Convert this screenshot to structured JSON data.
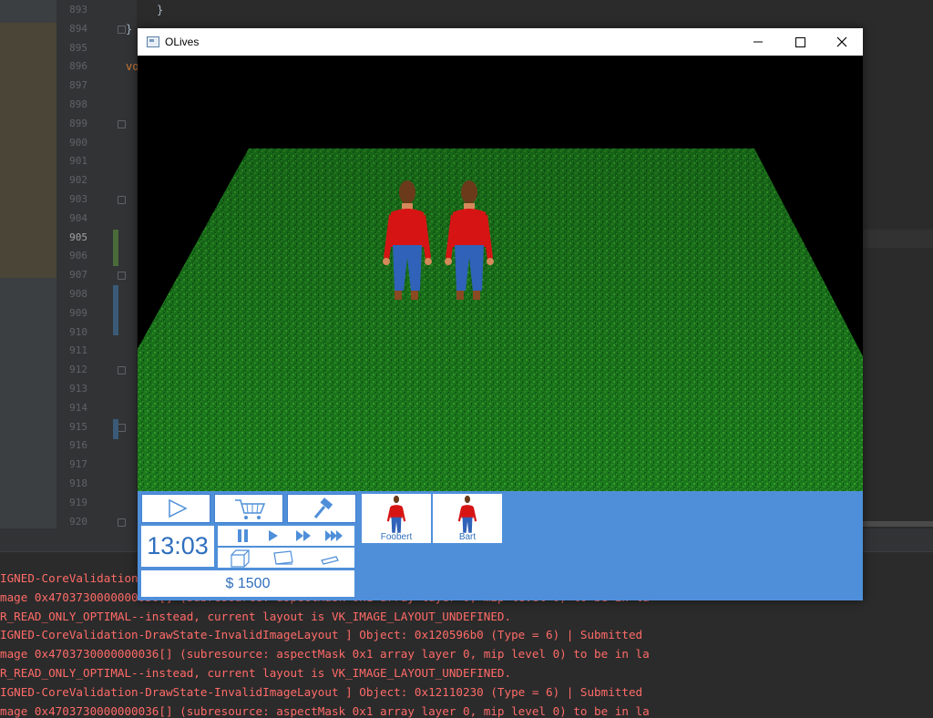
{
  "ide": {
    "line_numbers": [
      "893",
      "894",
      "895",
      "896",
      "897",
      "898",
      "899",
      "900",
      "901",
      "902",
      "903",
      "904",
      "905",
      "906",
      "907",
      "908",
      "909",
      "910",
      "911",
      "912",
      "913",
      "914",
      "915",
      "916",
      "917",
      "918",
      "919",
      "920"
    ],
    "current_line": "905",
    "code_snippets": {
      "brace_close": "}",
      "brace_line": "}",
      "fragment": "vo"
    }
  },
  "console": {
    "lines": [
      "IGNED-CoreValidation-DrawState-InvalidImageLayout ] Object: 0x12059b0 (Type = 6) | Submitted",
      "mage 0x4703730000000036[] (subresource: aspectMask 0x1 array layer 0, mip level 0) to be in la",
      "R_READ_ONLY_OPTIMAL--instead, current layout is VK_IMAGE_LAYOUT_UNDEFINED.",
      "IGNED-CoreValidation-DrawState-InvalidImageLayout ] Object: 0x120596b0 (Type = 6) | Submitted",
      "mage 0x4703730000000036[] (subresource: aspectMask 0x1 array layer 0, mip level 0) to be in la",
      "R_READ_ONLY_OPTIMAL--instead, current layout is VK_IMAGE_LAYOUT_UNDEFINED.",
      "IGNED-CoreValidation-DrawState-InvalidImageLayout ] Object: 0x12110230 (Type = 6) | Submitted",
      "mage 0x4703730000000036[] (subresource: aspectMask 0x1 array layer 0, mip level 0) to be in la"
    ]
  },
  "window": {
    "title": "OLives",
    "controls": {
      "minimize": "—",
      "maximize": "☐",
      "close": "✕"
    }
  },
  "hud": {
    "time": "13:03",
    "money": "$ 1500",
    "buttons": {
      "play": "play-icon",
      "shop": "cart-icon",
      "build": "hammer-icon",
      "pause": "pause-icon",
      "speed1": "play-icon",
      "speed2": "fast-forward-icon",
      "speed3": "ultra-fast-icon",
      "tool_box": "cube-icon",
      "tool_floor": "floor-icon",
      "tool_wall": "wall-icon"
    },
    "accent_color": "#4f8fd9",
    "characters": [
      {
        "name": "Foobert"
      },
      {
        "name": "Bart"
      }
    ]
  }
}
